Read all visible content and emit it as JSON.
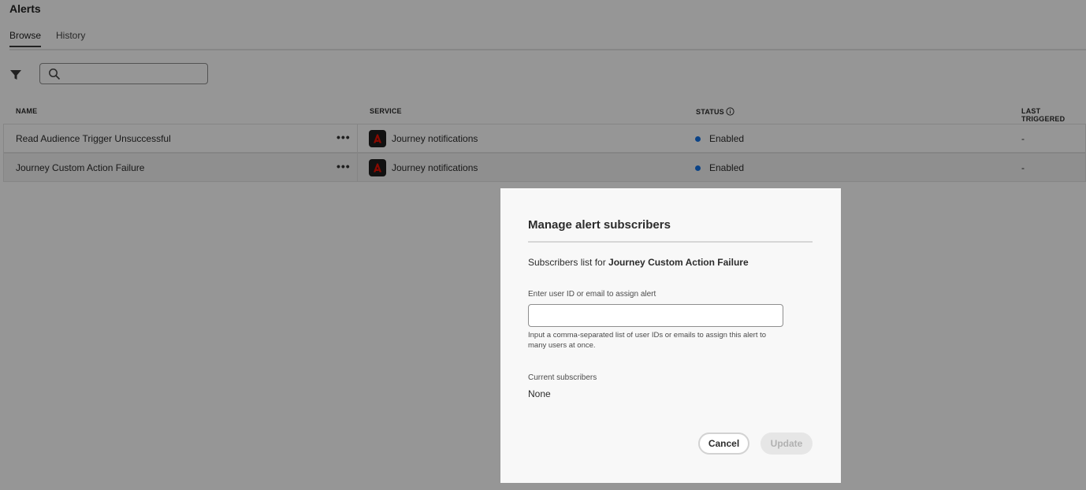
{
  "page": {
    "title": "Alerts",
    "tabs": [
      {
        "label": "Browse",
        "active": true
      },
      {
        "label": "History",
        "active": false
      }
    ]
  },
  "toolbar": {
    "filter_icon": "filter-icon",
    "search_icon": "search-icon",
    "search_value": "",
    "search_placeholder": ""
  },
  "table": {
    "columns": [
      "NAME",
      "SERVICE",
      "STATUS",
      "LAST TRIGGERED"
    ],
    "rows": [
      {
        "name": "Read Audience Trigger Unsuccessful",
        "more": "•••",
        "service": "Journey notifications",
        "status": "Enabled",
        "last_triggered": "-"
      },
      {
        "name": "Journey Custom Action Failure",
        "more": "•••",
        "service": "Journey notifications",
        "status": "Enabled",
        "last_triggered": "-"
      }
    ]
  },
  "dialog": {
    "title": "Manage alert subscribers",
    "subtitle_prefix": "Subscribers list for",
    "subtitle_alert": "Journey Custom Action Failure",
    "field_label": "Enter user ID or email to assign alert",
    "field_value": "",
    "help_text": "Input a comma-separated list of user IDs or emails to assign this alert to many users at once.",
    "current_label": "Current subscribers",
    "current_value": "None",
    "cancel_label": "Cancel",
    "update_label": "Update"
  },
  "colors": {
    "status_enabled": "#1473e6",
    "service_icon_bg": "#1e1e1e",
    "service_icon_fg": "#eb1000",
    "overlay": "rgba(0,0,0,0.41)"
  }
}
